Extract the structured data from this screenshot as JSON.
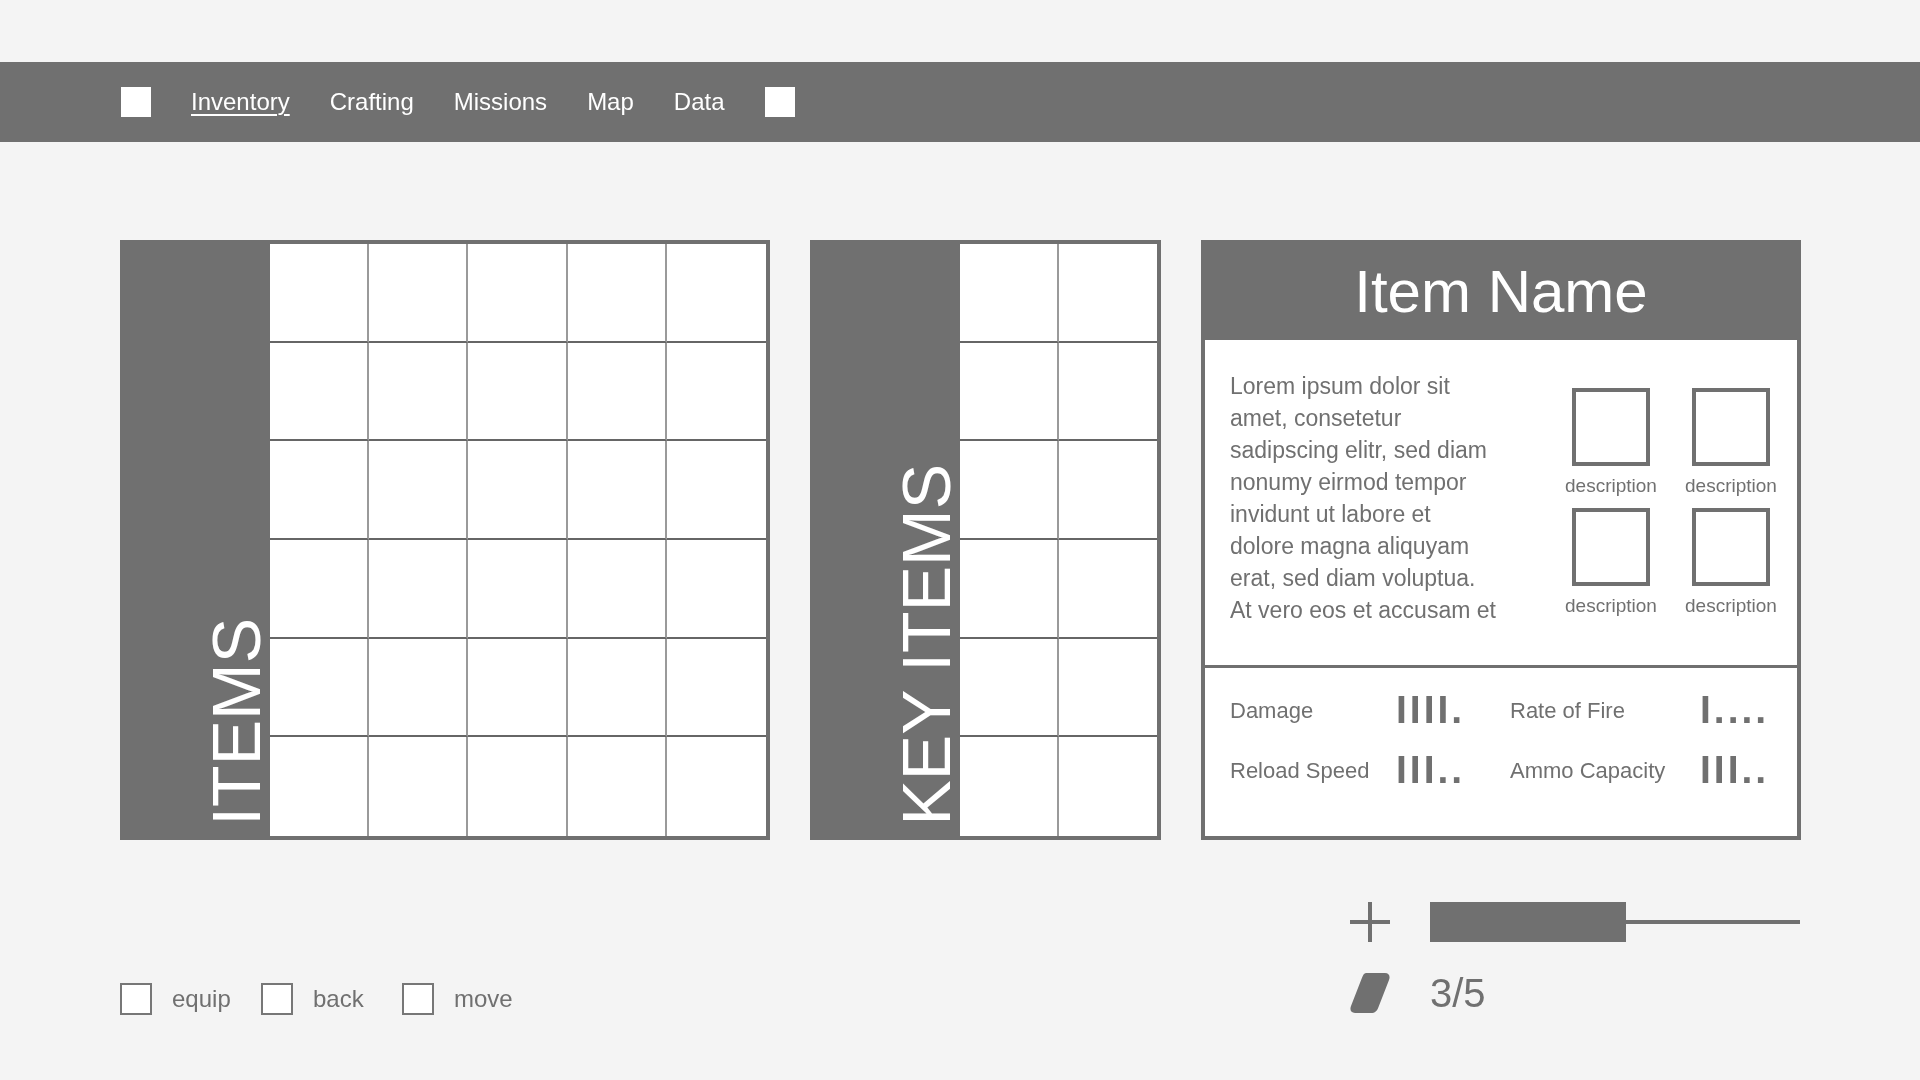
{
  "nav": {
    "tabs": [
      {
        "label": "Inventory",
        "selected": true
      },
      {
        "label": "Crafting",
        "selected": false
      },
      {
        "label": "Missions",
        "selected": false
      },
      {
        "label": "Map",
        "selected": false
      },
      {
        "label": "Data",
        "selected": false
      }
    ]
  },
  "items_panel": {
    "title": "ITEMS"
  },
  "key_items_panel": {
    "title": "KEY ITEMS"
  },
  "item_card": {
    "title": "Item Name",
    "description": "Lorem ipsum dolor sit amet, consetetur sadipscing elitr, sed diam nonumy eirmod tempor invidunt ut labore et dolore magna aliquyam erat, sed diam voluptua. At vero eos et accusam et",
    "attributes": [
      {
        "label": "description"
      },
      {
        "label": "description"
      },
      {
        "label": "description"
      },
      {
        "label": "description"
      }
    ],
    "stats": [
      {
        "label": "Damage",
        "rating": "IIII."
      },
      {
        "label": "Rate of Fire",
        "rating": "I...."
      },
      {
        "label": "Reload Speed",
        "rating": "III.."
      },
      {
        "label": "Ammo Capacity",
        "rating": "III.."
      }
    ]
  },
  "capacity": {
    "level": 0.53,
    "count": "3/5"
  },
  "hints": [
    {
      "label": "equip"
    },
    {
      "label": "back"
    },
    {
      "label": "move"
    }
  ]
}
